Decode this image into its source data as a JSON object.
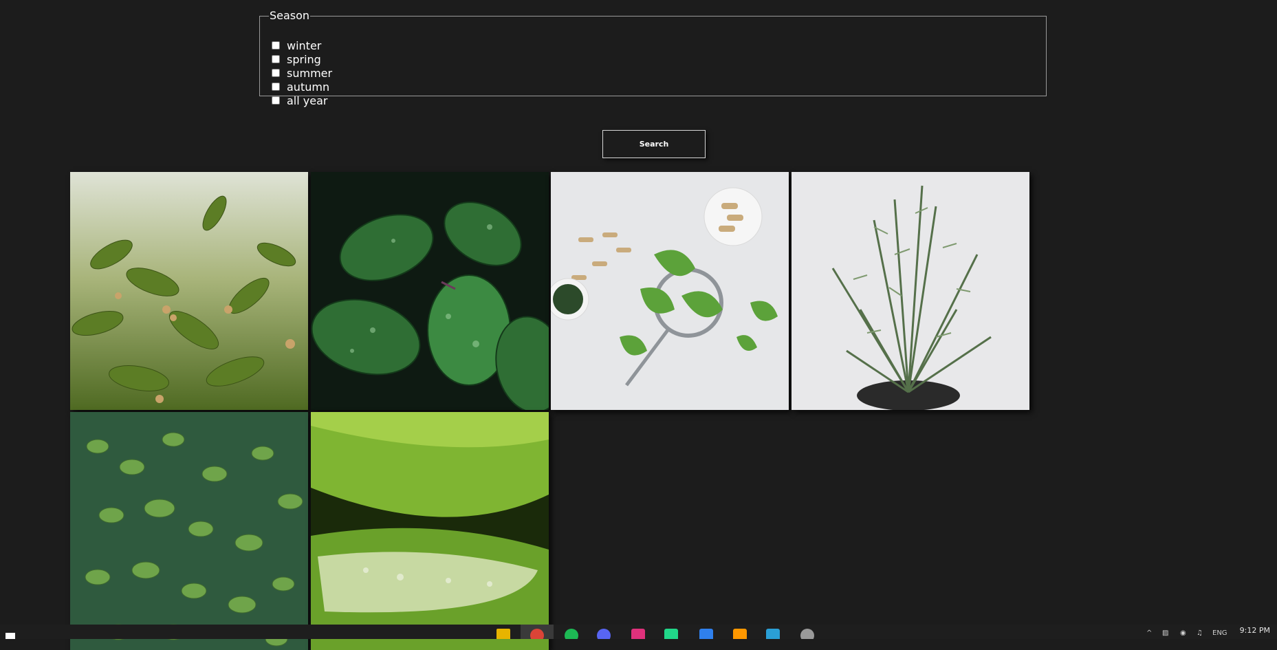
{
  "season": {
    "legend": "Season",
    "options": [
      {
        "label": "winter",
        "checked": false
      },
      {
        "label": "spring",
        "checked": false
      },
      {
        "label": "summer",
        "checked": false
      },
      {
        "label": "autumn",
        "checked": false
      },
      {
        "label": "all year",
        "checked": false
      }
    ]
  },
  "search": {
    "label": "Search"
  },
  "gallery": {
    "images": [
      {
        "subject": "ashwagandha-plant"
      },
      {
        "subject": "dewy-green-leaves"
      },
      {
        "subject": "ginkgo-leaves-and-capsules"
      },
      {
        "subject": "rosemary-in-pot"
      },
      {
        "subject": "thyme-plant"
      },
      {
        "subject": "aloe-vera-slices"
      }
    ]
  },
  "taskbar": {
    "language": "ENG",
    "time": "9:12 PM",
    "apps": [
      "file-explorer-icon",
      "chrome-icon",
      "spotify-icon",
      "discord-icon",
      "intellij-icon",
      "pycharm-icon",
      "vscode-icon",
      "sublime-icon",
      "photos-icon",
      "mail-icon"
    ]
  }
}
